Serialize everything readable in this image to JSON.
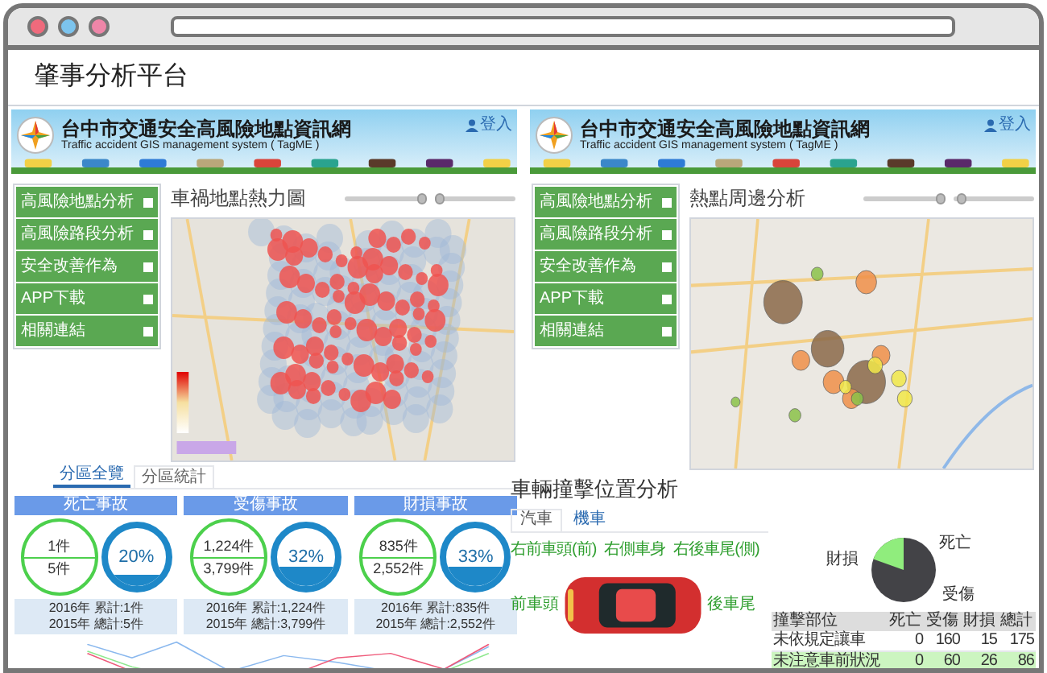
{
  "page_title": "肇事分析平台",
  "panels": [
    {
      "site_title": "台中市交通安全高風險地點資訊網",
      "site_subtitle": "Traffic accident GIS management system ( TagME )",
      "login": "登入",
      "menu": [
        {
          "label": "高風險地點分析"
        },
        {
          "label": "高風險路段分析"
        },
        {
          "label": "安全改善作為"
        },
        {
          "label": "APP下載"
        },
        {
          "label": "相關連結"
        }
      ],
      "heading": "車禍地點熱力圖",
      "sliders": [
        {
          "level": 0.95
        },
        {
          "level": 0.05
        }
      ]
    },
    {
      "site_title": "台中市交通安全高風險地點資訊網",
      "site_subtitle": "Traffic accident GIS management system ( TagME )",
      "login": "登入",
      "menu": [
        {
          "label": "高風險地點分析"
        },
        {
          "label": "高風險路段分析"
        },
        {
          "label": "安全改善作為"
        },
        {
          "label": "APP下載"
        },
        {
          "label": "相關連結"
        }
      ],
      "heading": "熱點周邊分析",
      "sliders": [
        {
          "level": 0.95
        },
        {
          "level": 0.1
        }
      ]
    }
  ],
  "district_stats": {
    "tabs": [
      {
        "label": "分區全覽",
        "selected": true
      },
      {
        "label": "分區統計",
        "selected": false
      }
    ],
    "cards": [
      {
        "title": "死亡事故",
        "current": "1件",
        "previous": "5件",
        "percent": "20%",
        "line1": "2016年 累計:1件",
        "line2": "2015年 總計:5件"
      },
      {
        "title": "受傷事故",
        "current": "1,224件",
        "previous": "3,799件",
        "percent": "32%",
        "line1": "2016年 累計:1,224件",
        "line2": "2015年 總計:3,799件"
      },
      {
        "title": "財損事故",
        "current": "835件",
        "previous": "2,552件",
        "percent": "33%",
        "line1": "2016年 累計:835件",
        "line2": "2015年 總計:2,552件"
      }
    ]
  },
  "impact": {
    "title": "車輛撞擊位置分析",
    "tabs": [
      {
        "label": "汽車",
        "selected": true
      },
      {
        "label": "機車",
        "selected": false
      }
    ],
    "car_labels": {
      "top": [
        "右前車頭(前)",
        "右側車身",
        "右後車尾(側)"
      ],
      "front": "前車頭",
      "rear": "後車尾"
    },
    "pie_labels": {
      "top": "死亡",
      "left": "財損",
      "bottom": "受傷"
    },
    "table": {
      "columns": [
        "撞擊部位",
        "死亡",
        "受傷",
        "財損",
        "總計"
      ],
      "rows": [
        {
          "cells": [
            "未依規定讓車",
            "0",
            "160",
            "15",
            "175"
          ],
          "selected": false
        },
        {
          "cells": [
            "未注意車前狀況",
            "0",
            "60",
            "26",
            "86"
          ],
          "selected": true
        }
      ]
    }
  }
}
